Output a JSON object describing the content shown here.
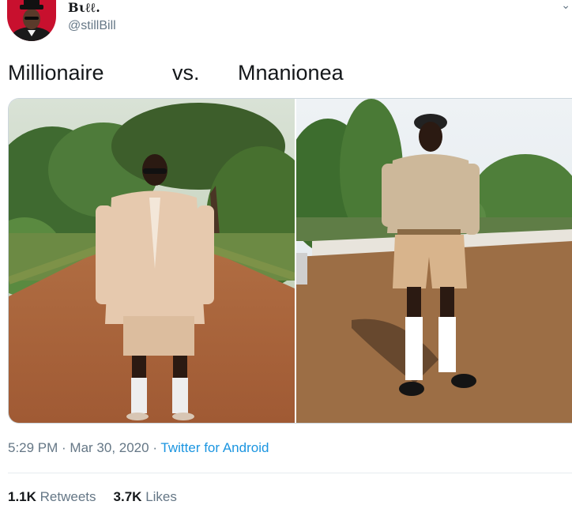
{
  "author": {
    "display_name": "Bιℓℓ.",
    "handle": "@stillBill"
  },
  "tweet": {
    "text_left": "Millionaire",
    "text_mid": "vs.",
    "text_right": "Mnanionea"
  },
  "meta": {
    "time": "5:29 PM",
    "sep1": " · ",
    "date": "Mar 30, 2020",
    "sep2": " · ",
    "source": "Twitter for Android"
  },
  "stats": {
    "retweets_count": "1.1K",
    "retweets_label": "Retweets",
    "likes_count": "3.7K",
    "likes_label": "Likes"
  },
  "colors": {
    "link": "#1b95e0",
    "secondary": "#657786",
    "text": "#14171a",
    "avatar_bg": "#c8102e"
  }
}
